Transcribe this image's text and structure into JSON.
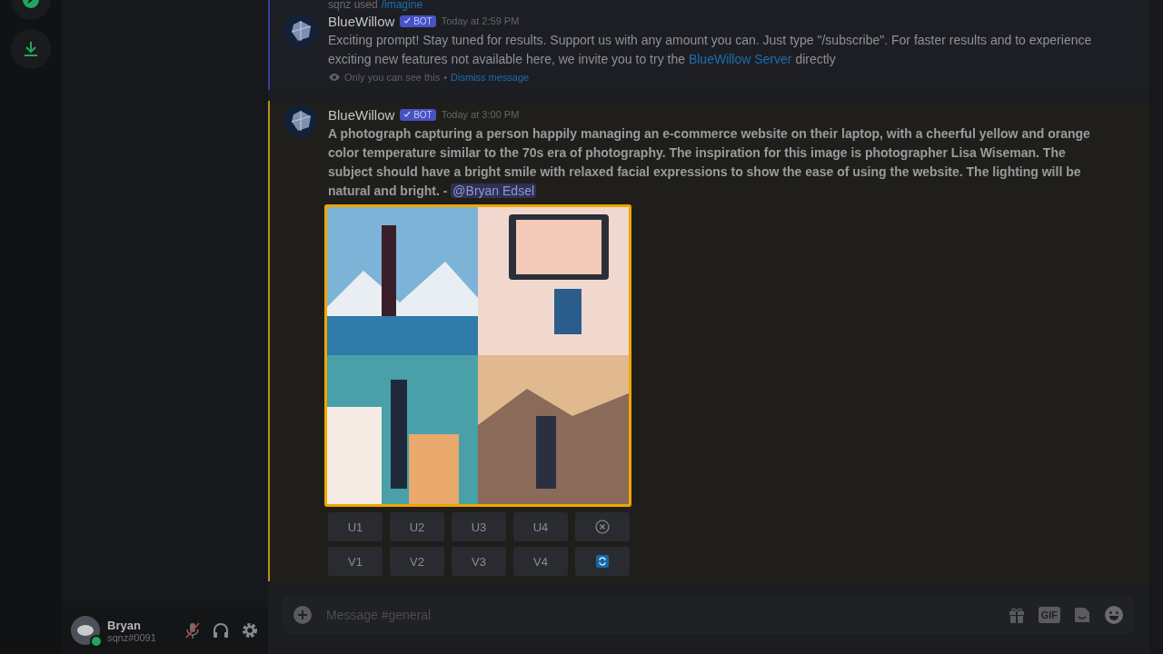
{
  "user_panel": {
    "name": "Bryan",
    "tag": "sqnz#0091",
    "mic_muted": true
  },
  "messages": [
    {
      "kind": "ephemeral",
      "reply": {
        "user": "sqnz used",
        "command": "/imagine"
      },
      "author": "BlueWillow",
      "badge": "BOT",
      "time": "Today at 2:59 PM",
      "text_before": "Exciting prompt! Stay tuned for results. Support us with any amount you can. Just type \"/subscribe\". For faster results and to experience exciting new features not available here, we invite you to try the",
      "link": "BlueWillow Server",
      "text_after": "directly",
      "notice": "Only you can see this",
      "separator": "•",
      "dismiss": "Dismiss message"
    },
    {
      "kind": "result",
      "author": "BlueWillow",
      "badge": "BOT",
      "time": "Today at 3:00 PM",
      "prompt": "A photograph capturing a person happily managing an e-commerce website on their laptop, with a cheerful yellow and orange color temperature similar to the 70s era of photography. The inspiration for this image is photographer Lisa Wiseman. The subject should have a bright smile with relaxed facial expressions to show the ease of using the website. The lighting will be natural and bright.",
      "dash": "-",
      "mention": "@Bryan Edsel",
      "button_rows": [
        [
          {
            "kind": "text",
            "label": "U1"
          },
          {
            "kind": "text",
            "label": "U2"
          },
          {
            "kind": "text",
            "label": "U3"
          },
          {
            "kind": "text",
            "label": "U4"
          },
          {
            "kind": "cancel"
          }
        ],
        [
          {
            "kind": "text",
            "label": "V1"
          },
          {
            "kind": "text",
            "label": "V2"
          },
          {
            "kind": "text",
            "label": "V3"
          },
          {
            "kind": "text",
            "label": "V4"
          },
          {
            "kind": "reroll"
          }
        ]
      ]
    }
  ],
  "composer": {
    "placeholder": "Message #general",
    "gif": "GIF"
  }
}
